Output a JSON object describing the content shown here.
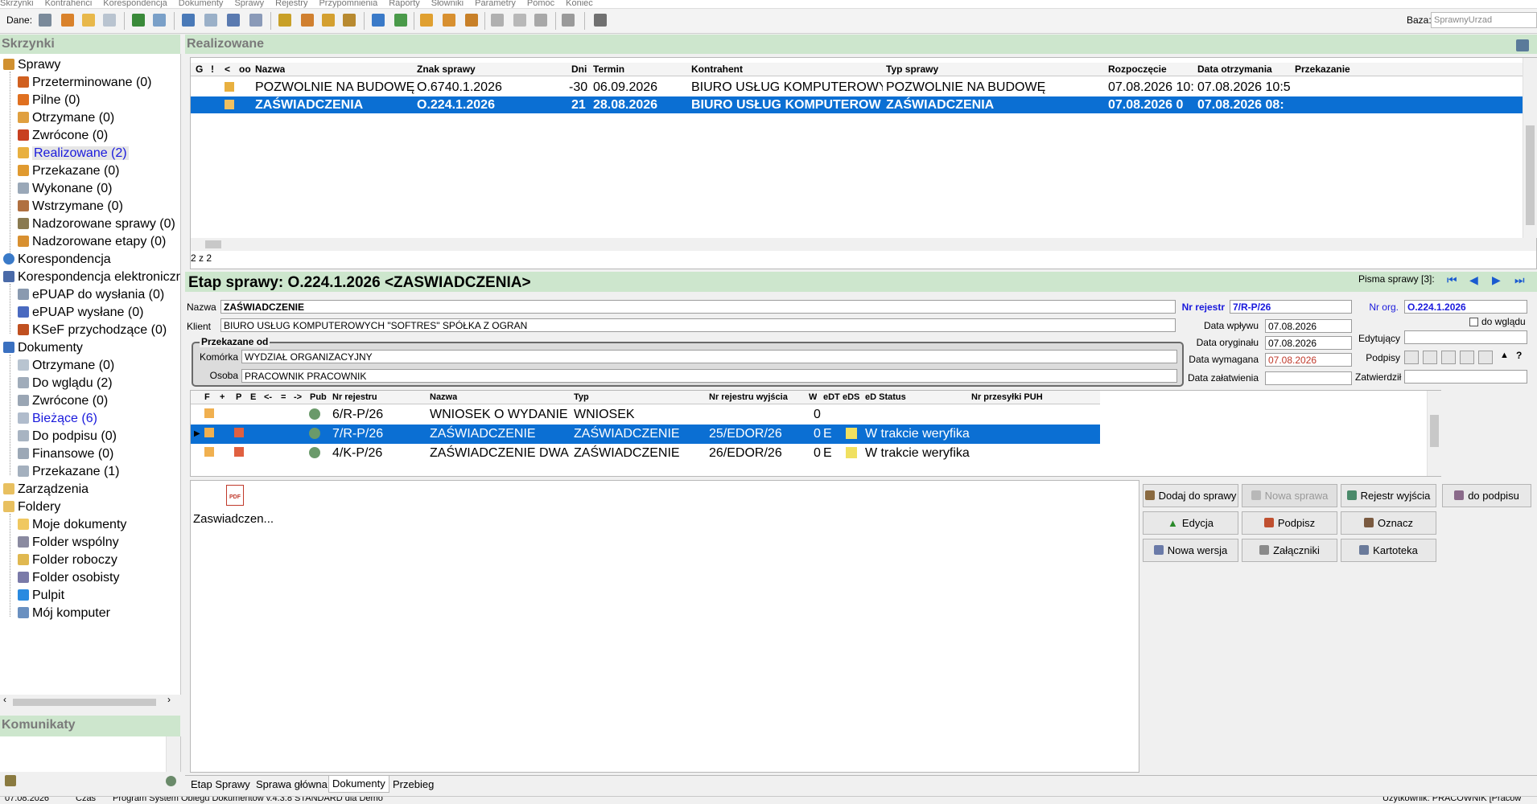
{
  "menubar": [
    "Skrzynki",
    "Kontrahenci",
    "Korespondencja",
    "Dokumenty",
    "Sprawy",
    "Rejestry",
    "Przypomnienia",
    "Raporty",
    "Słowniki",
    "Parametry",
    "Pomoc",
    "Koniec"
  ],
  "toolbar": {
    "dane_label": "Dane:",
    "baza_label": "Baza:",
    "baza_value": "SprawnyUrzad"
  },
  "skrzynki": {
    "title": "Skrzynki",
    "items": [
      {
        "label": "Sprawy",
        "icon": "case-folder-icon"
      },
      {
        "label": "Przeterminowane (0)",
        "icon": "overdue-icon"
      },
      {
        "label": "Pilne (0)",
        "icon": "urgent-icon"
      },
      {
        "label": "Otrzymane (0)",
        "icon": "inbox-icon"
      },
      {
        "label": "Zwrócone (0)",
        "icon": "returned-icon"
      },
      {
        "label": "Realizowane (2)",
        "icon": "in-progress-icon"
      },
      {
        "label": "Przekazane (0)",
        "icon": "forwarded-icon"
      },
      {
        "label": "Wykonane (0)",
        "icon": "done-icon"
      },
      {
        "label": "Wstrzymane (0)",
        "icon": "paused-icon"
      },
      {
        "label": "Nadzorowane sprawy (0)",
        "icon": "supervised-icon"
      },
      {
        "label": "Nadzorowane etapy (0)",
        "icon": "supervised-stage-icon"
      },
      {
        "label": "Korespondencja",
        "icon": "globe-icon"
      },
      {
        "label": "Korespondencja elektroniczr",
        "icon": "stack-icon"
      },
      {
        "label": "ePUAP do wysłania (0)",
        "icon": "epuap-send-icon"
      },
      {
        "label": "ePUAP wysłane (0)",
        "icon": "epuap-sent-icon"
      },
      {
        "label": "KSeF przychodzące (0)",
        "icon": "ksef-icon"
      },
      {
        "label": "Dokumenty",
        "icon": "documents-icon"
      },
      {
        "label": "Otrzymane (0)",
        "icon": "doc-icon"
      },
      {
        "label": "Do wglądu (2)",
        "icon": "doc-view-icon"
      },
      {
        "label": "Zwrócone (0)",
        "icon": "doc-return-icon"
      },
      {
        "label": "Bieżące (6)",
        "icon": "doc-current-icon"
      },
      {
        "label": "Do podpisu (0)",
        "icon": "doc-sign-icon"
      },
      {
        "label": "Finansowe (0)",
        "icon": "doc-finance-icon"
      },
      {
        "label": "Przekazane (1)",
        "icon": "doc-forward-icon"
      },
      {
        "label": "Zarządzenia",
        "icon": "folder-icon"
      },
      {
        "label": "Foldery",
        "icon": "folder-icon"
      },
      {
        "label": "Moje dokumenty",
        "icon": "folder-icon"
      },
      {
        "label": "Folder wspólny",
        "icon": "users-icon"
      },
      {
        "label": "Folder roboczy",
        "icon": "folder-icon"
      },
      {
        "label": "Folder osobisty",
        "icon": "person-icon"
      },
      {
        "label": "Pulpit",
        "icon": "desktop-icon"
      },
      {
        "label": "Mój komputer",
        "icon": "computer-icon"
      }
    ]
  },
  "komunikaty": {
    "title": "Komunikaty"
  },
  "realizowane": {
    "title": "Realizowane",
    "columns": [
      "G",
      "!",
      "<",
      "oo",
      "Nazwa",
      "Znak sprawy",
      "Dni",
      "Termin",
      "Kontrahent",
      "Typ sprawy",
      "Rozpoczęcie",
      "Data otrzymania",
      "Przekazanie"
    ],
    "rows": [
      {
        "nazwa": "POZWOLNIE NA BUDOWĘ",
        "znak": "O.6740.1.2026",
        "dni": "-30",
        "termin": "06.09.2026",
        "kontrahent": "BIURO USŁUG KOMPUTEROWYCH",
        "typ": "POZWOLNIE NA BUDOWĘ",
        "rozpoczecie": "07.08.2026 10:",
        "data_otrz": "07.08.2026 10:5",
        "przekazanie": ""
      },
      {
        "nazwa": "ZAŚWIADCZENIA",
        "znak": "O.224.1.2026",
        "dni": "21",
        "termin": "28.08.2026",
        "kontrahent": "BIURO USŁUG KOMPUTEROW",
        "typ": "ZAŚWIADCZENIA",
        "rozpoczecie": "07.08.2026 0",
        "data_otrz": "07.08.2026 08:",
        "przekazanie": ""
      }
    ],
    "count": "2 z 2"
  },
  "etap": {
    "title": "Etap sprawy: O.224.1.2026 <ZASWIADCZENIA>",
    "pisma_label": "Pisma sprawy [3]:",
    "nazwa_label": "Nazwa",
    "nazwa_value": "ZAŚWIADCZENIE",
    "klient_label": "Klient",
    "klient_value": "BIURO USŁUG KOMPUTEROWYCH \"SOFTRES\" SPÓŁKA Z OGRAN",
    "przekazane_label": "Przekazane od",
    "komorka_label": "Komórka",
    "komorka_value": "WYDZIAŁ ORGANIZACYJNY",
    "osoba_label": "Osoba",
    "osoba_value": "PRACOWNIK PRACOWNIK",
    "nr_rejestr_label": "Nr rejestr",
    "nr_rejestr_value": "7/R-P/26",
    "nr_org_label": "Nr org.",
    "nr_org_value": "O.224.1.2026",
    "do_wgladu_label": "do wglądu",
    "data_wplywu_label": "Data wpływu",
    "data_wplywu_value": "07.08.2026",
    "data_oryginalu_label": "Data oryginału",
    "data_oryginalu_value": "07.08.2026",
    "data_wymagana_label": "Data wymagana",
    "data_wymagana_value": "07.08.2026",
    "data_zalatwienia_label": "Data załatwienia",
    "data_zalatwienia_value": "",
    "edytujacy_label": "Edytujący",
    "podpisy_label": "Podpisy",
    "zatwierdzil_label": "Zatwierdził"
  },
  "docs": {
    "columns": [
      "F",
      "+",
      "P",
      "E",
      "<-",
      "=",
      "->",
      "Pub",
      "Nr rejestru",
      "Nazwa",
      "Typ",
      "Nr rejestru wyjścia",
      "W",
      "eDT",
      "eDS",
      "eD Status",
      "Nr przesyłki PUH"
    ],
    "rows": [
      {
        "nr": "6/R-P/26",
        "nazwa": "WNIOSEK O WYDANIE Z",
        "typ": "WNIOSEK",
        "nr_wyj": "",
        "w": "0",
        "edt": "",
        "status": ""
      },
      {
        "nr": "7/R-P/26",
        "nazwa": "ZAŚWIADCZENIE",
        "typ": "ZAŚWIADCZENIE",
        "nr_wyj": "25/EDOR/26",
        "w": "0",
        "edt": "E",
        "status": "W trakcie weryfika"
      },
      {
        "nr": "4/K-P/26",
        "nazwa": "ZAŚWIADCZENIE DWA",
        "typ": "ZAŚWIADCZENIE",
        "nr_wyj": "26/EDOR/26",
        "w": "0",
        "edt": "E",
        "status": "W trakcie weryfika"
      }
    ]
  },
  "attachment": {
    "label": "Zaswiadczen..."
  },
  "buttons": {
    "dodaj": "Dodaj do sprawy",
    "nowa_sprawa": "Nowa sprawa",
    "rejestr_wyjscia": "Rejestr wyjścia",
    "do_podpisu": "do podpisu",
    "edycja": "Edycja",
    "podpisz": "Podpisz",
    "oznacz": "Oznacz",
    "nowa_wersja": "Nowa wersja",
    "zalaczniki": "Załączniki",
    "kartoteka": "Kartoteka"
  },
  "tabs": [
    "Etap Sprawy",
    "Sprawa główna",
    "Dokumenty",
    "Przebieg"
  ],
  "statusbar": {
    "date": "07.08.2026",
    "czas": "Czas",
    "program": "Program System Obiegu Dokumentów v.4.3.8 STANDARD dla Demo",
    "user": "Użytkownik: PRACOWNIK [Pracow"
  },
  "colors": {
    "selection": "#0b6fd3",
    "panel_header": "#cde6cd",
    "link_blue": "#1a1adc",
    "required_red": "#c0392b"
  }
}
